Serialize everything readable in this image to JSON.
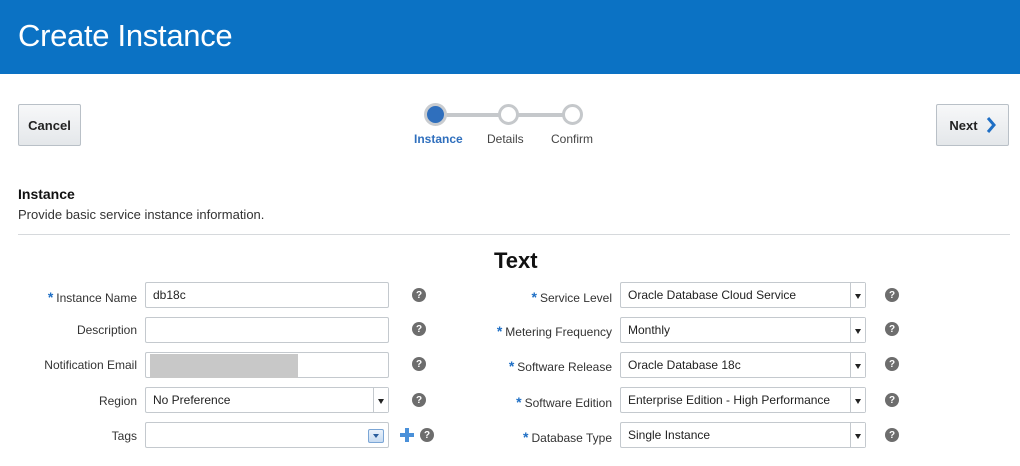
{
  "header": {
    "title": "Create Instance"
  },
  "toolbar": {
    "cancel_label": "Cancel",
    "next_label": "Next"
  },
  "train": {
    "steps": [
      {
        "label": "Instance",
        "state": "current"
      },
      {
        "label": "Details",
        "state": "todo"
      },
      {
        "label": "Confirm",
        "state": "todo"
      }
    ]
  },
  "section": {
    "title": "Instance",
    "description": "Provide basic service instance information."
  },
  "overlay_text": "Text",
  "left_form": {
    "instance_name": {
      "label": "Instance Name",
      "value": "db18c",
      "required": true
    },
    "description": {
      "label": "Description",
      "value": ""
    },
    "notification_email": {
      "label": "Notification Email",
      "value": ""
    },
    "region": {
      "label": "Region",
      "value": "No Preference"
    },
    "tags": {
      "label": "Tags",
      "value": ""
    }
  },
  "right_form": {
    "service_level": {
      "label": "Service Level",
      "value": "Oracle Database Cloud Service",
      "required": true
    },
    "metering_frequency": {
      "label": "Metering Frequency",
      "value": "Monthly",
      "required": true
    },
    "software_release": {
      "label": "Software Release",
      "value": "Oracle Database 18c",
      "required": true
    },
    "software_edition": {
      "label": "Software Edition",
      "value": "Enterprise Edition - High Performance",
      "required": true
    },
    "database_type": {
      "label": "Database Type",
      "value": "Single Instance",
      "required": true
    }
  },
  "required_marker": "*",
  "help_glyph": "?",
  "icons": {
    "help": "help-icon",
    "next": "chevron-right-icon",
    "add": "plus-icon",
    "dropdown": "chevron-down-icon"
  },
  "colors": {
    "header_bg": "#0b72c4",
    "accent": "#2f6fbd",
    "required": "#1f6fc5"
  }
}
